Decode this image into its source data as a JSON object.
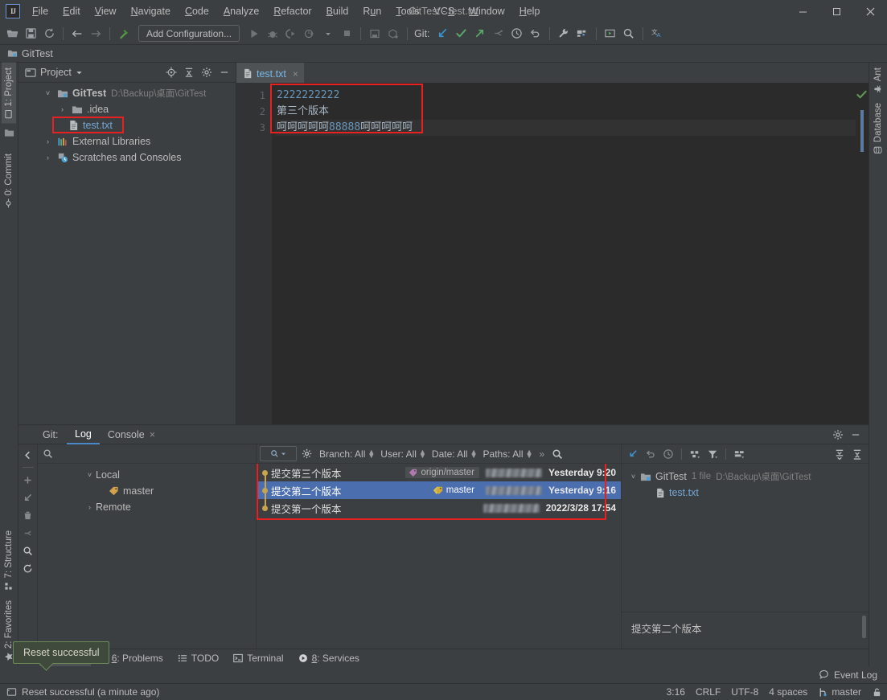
{
  "window": {
    "title": "GitTest - test.txt",
    "minimize_label": "—",
    "maximize_label": "☐",
    "close_label": "×",
    "logo_text": "IJ"
  },
  "menu": [
    {
      "label": "File",
      "mnemonic": "F"
    },
    {
      "label": "Edit",
      "mnemonic": "E"
    },
    {
      "label": "View",
      "mnemonic": "V"
    },
    {
      "label": "Navigate",
      "mnemonic": "N"
    },
    {
      "label": "Code",
      "mnemonic": "C"
    },
    {
      "label": "Analyze",
      "mnemonic": "A"
    },
    {
      "label": "Refactor",
      "mnemonic": "R"
    },
    {
      "label": "Build",
      "mnemonic": "B"
    },
    {
      "label": "Run",
      "mnemonic": "u"
    },
    {
      "label": "Tools",
      "mnemonic": "T"
    },
    {
      "label": "VCS",
      "mnemonic": "S"
    },
    {
      "label": "Window",
      "mnemonic": "W"
    },
    {
      "label": "Help",
      "mnemonic": "H"
    }
  ],
  "toolbar": {
    "run_config_label": "Add Configuration...",
    "git_label": "Git:",
    "icons": [
      "open-folder-icon",
      "save-all-icon",
      "sync-icon",
      "back-arrow-icon",
      "forward-arrow-icon",
      "build-hammer-icon"
    ],
    "run_icons": [
      "run-icon",
      "debug-icon",
      "run-with-coverage-icon",
      "profile-icon",
      "dropdown-icon",
      "stop-icon"
    ],
    "misc_icons": [
      "layout-icon",
      "update-project-icon"
    ],
    "git_icons": [
      "update-project-arrow-icon",
      "commit-check-icon",
      "push-arrow-icon",
      "branch-icon",
      "history-clock-icon",
      "revert-icon"
    ],
    "right_icons": [
      "wrench-settings-icon",
      "project-structure-icon",
      "run-anything-icon",
      "search-everywhere-icon",
      "translate-icon"
    ]
  },
  "navbar": {
    "project_name": "GitTest",
    "icon": "project-module-icon"
  },
  "left_stripe": [
    {
      "label": "1: Project",
      "icon": "project-icon",
      "active": true
    },
    {
      "label": "0: Commit",
      "icon": "commit-icon",
      "active": false
    },
    {
      "label": "7: Structure",
      "icon": "structure-icon",
      "active": false
    },
    {
      "label": "2: Favorites",
      "icon": "star-icon",
      "active": false
    }
  ],
  "right_stripe": [
    {
      "label": "Ant",
      "icon": "ant-bug-icon"
    },
    {
      "label": "Database",
      "icon": "database-icon"
    }
  ],
  "project_panel": {
    "title": "Project",
    "dropdown_icon": "chevron-down-icon",
    "actions": [
      "locate-target-icon",
      "collapse-all-icon",
      "gear-icon",
      "hide-icon"
    ],
    "tree": [
      {
        "label": "GitTest",
        "path": "D:\\Backup\\桌面\\GitTest",
        "arrow": "˅",
        "indent": 0,
        "icon": "module-icon",
        "bold": true
      },
      {
        "label": ".idea",
        "path": "",
        "arrow": "›",
        "indent": 1,
        "icon": "folder-icon",
        "bold": false
      },
      {
        "label": "test.txt",
        "path": "",
        "arrow": "",
        "indent": 2,
        "icon": "text-file-icon",
        "bold": false,
        "file": true,
        "highlighted": true
      },
      {
        "label": "External Libraries",
        "path": "",
        "arrow": "›",
        "indent": 0,
        "icon": "libraries-icon",
        "bold": false
      },
      {
        "label": "Scratches and Consoles",
        "path": "",
        "arrow": "›",
        "indent": 0,
        "icon": "scratches-icon",
        "bold": false
      }
    ]
  },
  "editor": {
    "tab": {
      "name": "test.txt",
      "icon": "text-file-icon",
      "close": "×"
    },
    "lines": [
      {
        "number": "1",
        "text": "2222222222",
        "kind": "number"
      },
      {
        "number": "2",
        "text": "第三个版本",
        "kind": "text"
      },
      {
        "number": "3",
        "text": "呵呵呵呵呵88888呵呵呵呵呵",
        "kind": "mixed",
        "current": true
      }
    ],
    "line3_parts": [
      {
        "t": "呵呵呵呵呵",
        "k": "text"
      },
      {
        "t": "88888",
        "k": "number"
      },
      {
        "t": "呵呵呵呵呵",
        "k": "text"
      }
    ],
    "inspection_icon": "ok-check-icon"
  },
  "git_tool_window": {
    "label": "Git:",
    "tabs": [
      {
        "label": "Log",
        "active": true,
        "closable": false
      },
      {
        "label": "Console",
        "active": false,
        "closable": true,
        "close": "×"
      }
    ],
    "header_actions": [
      "gear-icon",
      "hide-icon"
    ],
    "vertical_toolbar": [
      "collapse-left-icon",
      "add-icon",
      "fetch-icon",
      "delete-icon",
      "merge-icon",
      "search-icon",
      "refresh-icon"
    ],
    "branch_search_placeholder": "",
    "branch_search_icon": "search-icon",
    "branches": [
      {
        "label": "Local",
        "arrow": "˅",
        "indent": 0,
        "icon": ""
      },
      {
        "label": "master",
        "arrow": "",
        "indent": 1,
        "icon": "branch-tag-icon"
      },
      {
        "label": "Remote",
        "arrow": "›",
        "indent": 0,
        "icon": ""
      }
    ],
    "log_toolbar": {
      "search_icon": "text-filter-icon",
      "gear_icon": "gear-icon",
      "filters": [
        {
          "label": "Branch: All"
        },
        {
          "label": "User: All"
        },
        {
          "label": "Date: All"
        },
        {
          "label": "Paths: All"
        }
      ],
      "overflow": "»",
      "search": "search-icon",
      "right_icons": [
        "highlight-my-commits-icon",
        "revert-icon",
        "history-clock-icon",
        "intellisort-icon",
        "filter-icon",
        "show-long-edges-icon",
        "expand-all-icon",
        "collapse-all-icon"
      ]
    },
    "commits": [
      {
        "subject": "提交第三个版本",
        "ref": "origin/master",
        "ref_icon": "remote-branch-label-icon",
        "author": "redacted",
        "date": "Yesterday 9:20",
        "selected": false
      },
      {
        "subject": "提交第二个版本",
        "ref": "master",
        "ref_icon": "local-branch-label-icon",
        "author": "redacted",
        "date": "Yesterday 9:16",
        "selected": true
      },
      {
        "subject": "提交第一个版本",
        "ref": "",
        "ref_icon": "",
        "author": "redacted",
        "date": "2022/3/28 17:54",
        "selected": false
      }
    ],
    "details": {
      "root_label": "GitTest",
      "file_count": "1 file",
      "root_path": "D:\\Backup\\桌面\\GitTest",
      "arrow": "˅",
      "files": [
        {
          "name": "test.txt",
          "icon": "text-file-icon"
        }
      ],
      "commit_message": "提交第二个版本"
    }
  },
  "balloon": {
    "text": "Reset successful"
  },
  "tool_window_bar": [
    {
      "label": "9: Git",
      "mnemonic": "9",
      "icon": "git-branch-icon",
      "active": true
    },
    {
      "label": "6: Problems",
      "mnemonic": "6",
      "icon": "problems-icon",
      "active": false
    },
    {
      "label": "TODO",
      "mnemonic": "",
      "icon": "todo-list-icon",
      "active": false
    },
    {
      "label": "Terminal",
      "mnemonic": "",
      "icon": "terminal-icon",
      "active": false
    },
    {
      "label": "8: Services",
      "mnemonic": "8",
      "icon": "services-icon",
      "active": false
    }
  ],
  "status_bar": {
    "message": "Reset successful (a minute ago)",
    "message_icon": "balloon-icon",
    "event_log": "Event Log",
    "event_log_icon": "event-log-icon",
    "caret_position": "3:16",
    "line_separator": "CRLF",
    "encoding": "UTF-8",
    "indent": "4 spaces",
    "branch": "master",
    "branch_icon": "git-branch-icon",
    "lock_icon": "read-only-lock-icon"
  },
  "colors": {
    "background": "#3c3f41",
    "editor_background": "#2b2b2b",
    "accent_blue": "#4b6eaf",
    "selected_tab_underline": "#4a88c7",
    "annotation_red": "#e82020",
    "graph_node": "#c9a34e",
    "success_green": "#629755",
    "file_link": "#74a7d6"
  }
}
